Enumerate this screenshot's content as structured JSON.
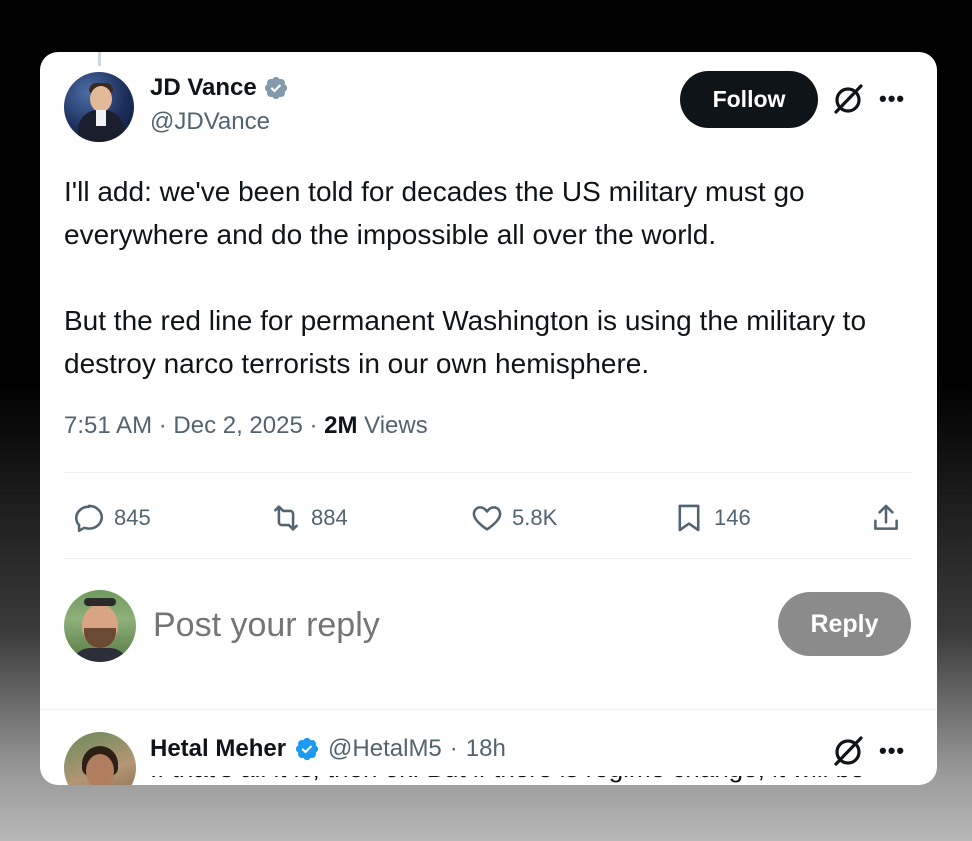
{
  "tweet": {
    "author": {
      "display_name": "JD Vance",
      "handle": "@JDVance",
      "verified_badge_color": "#829aab"
    },
    "follow_label": "Follow",
    "more_icon": "•••",
    "paragraphs": [
      "I'll add: we've been told for decades the US military must go everywhere and do the impossible all over the world.",
      "But the red line for permanent Washington is using the military to destroy narco terrorists in our own hemisphere."
    ],
    "meta": {
      "time": "7:51 AM",
      "sep1": " · ",
      "date": "Dec 2, 2025",
      "sep2": " · ",
      "views_count": "2M",
      "views_label": " Views"
    },
    "actions": {
      "replies": "845",
      "reposts": "884",
      "likes": "5.8K",
      "bookmarks": "146"
    }
  },
  "composer": {
    "placeholder": "Post your reply",
    "reply_label": "Reply"
  },
  "reply": {
    "display_name": "Hetal Meher",
    "handle": "@HetalM5",
    "separator": "·",
    "time": "18h",
    "text": "If that's all it is, then ok. But if there is regime change, it will be",
    "verified_badge_color": "#1d9bf0"
  },
  "colors": {
    "text_primary": "#0f1419",
    "text_secondary": "#536471",
    "follow_bg": "#0f1419",
    "reply_btn_bg": "#8b8b8b",
    "divider": "#eff3f4"
  }
}
